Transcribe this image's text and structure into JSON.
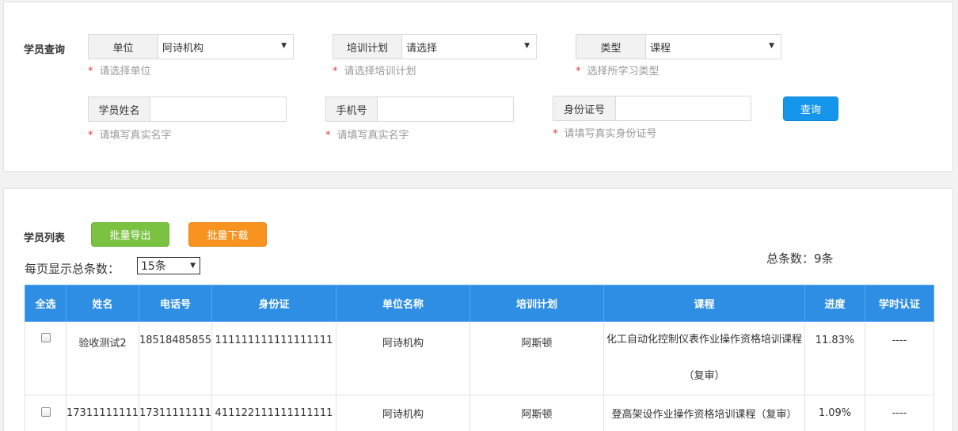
{
  "query": {
    "section_title": "学员查询",
    "unit": {
      "label": "单位",
      "value": "阿诗机构",
      "hint": "请选择单位"
    },
    "plan": {
      "label": "培训计划",
      "value": "请选择",
      "hint": "请选择培训计划"
    },
    "type": {
      "label": "类型",
      "value": "课程",
      "hint": "选择所学习类型"
    },
    "name": {
      "label": "学员姓名",
      "value": "",
      "hint": "请填写真实名字"
    },
    "phone": {
      "label": "手机号",
      "value": "",
      "hint": "请填写真实名字"
    },
    "idcard": {
      "label": "身份证号",
      "value": "",
      "hint": "请填写真实身份证号"
    },
    "search_button": "查询",
    "required_mark": "*"
  },
  "list": {
    "section_title": "学员列表",
    "export_button": "批量导出",
    "download_button": "批量下载",
    "page_size_label": "每页显示总条数：",
    "page_size_value": "15条",
    "total_text": "总条数：9条",
    "columns": [
      "全选",
      "姓名",
      "电话号",
      "身份证",
      "单位名称",
      "培训计划",
      "课程",
      "进度",
      "学时认证"
    ],
    "rows": [
      {
        "name": "验收测试2",
        "phone": "18518485855",
        "idcard": "111111111111111111",
        "unit": "阿诗机构",
        "plan": "阿斯顿",
        "course": "化工自动化控制仪表作业操作资格培训课程（复审）",
        "progress": "11.83%",
        "cert": "----",
        "checked": false
      },
      {
        "name": "17311111111",
        "phone": "17311111111",
        "idcard": "411122111111111111",
        "unit": "阿诗机构",
        "plan": "阿斯顿",
        "course": "登高架设作业操作资格培训课程（复审）",
        "progress": "1.09%",
        "cert": "----",
        "checked": false
      }
    ]
  },
  "colors": {
    "primary": "#1596ea",
    "export": "#7cc242",
    "download": "#f7931e",
    "table_header": "#2d8ee4",
    "required": "#e4393c"
  }
}
